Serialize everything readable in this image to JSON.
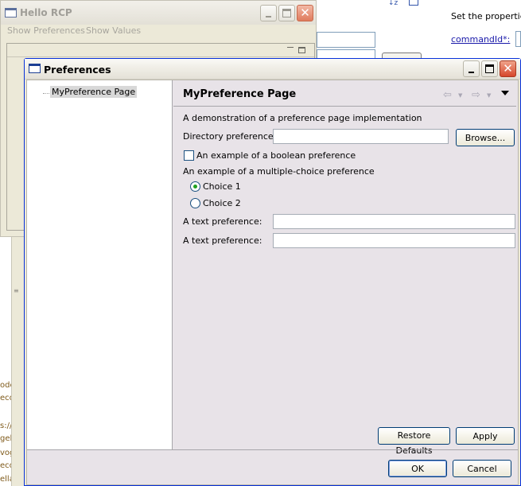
{
  "background": {
    "code_fragments": [
      "ode",
      "eco",
      "s://",
      "gel",
      "vog",
      "eco",
      "ella"
    ],
    "sort_icons": "↓z",
    "right_panel": {
      "description": "Set the properties",
      "field_label": "commandId*:"
    }
  },
  "rcp_window": {
    "title": "Hello RCP",
    "menu": [
      "Show Preferences",
      "Show Values"
    ]
  },
  "preferences": {
    "title": "Preferences",
    "tree_items": [
      {
        "label": "MyPreference Page",
        "selected": true
      }
    ],
    "page": {
      "title": "MyPreference Page",
      "description": "A demonstration of a preference page implementation",
      "directory_label": "Directory preference:",
      "directory_value": "",
      "browse_label": "Browse...",
      "boolean_label": "An example of a boolean preference",
      "boolean_checked": false,
      "choice_group_label": "An example of a multiple-choice preference",
      "choices": [
        {
          "label": "Choice 1",
          "selected": true
        },
        {
          "label": "Choice 2",
          "selected": false
        }
      ],
      "text_fields": [
        {
          "label": "A text preference:",
          "value": ""
        },
        {
          "label": "A text preference:",
          "value": ""
        }
      ],
      "restore_defaults_label": "Restore Defaults",
      "apply_label": "Apply"
    },
    "ok_label": "OK",
    "cancel_label": "Cancel"
  },
  "colors": {
    "dialog_frame": "#0831d9",
    "page_background": "#e8e3e8",
    "radio_selected": "#21a121",
    "close_button": "#e2614a"
  }
}
